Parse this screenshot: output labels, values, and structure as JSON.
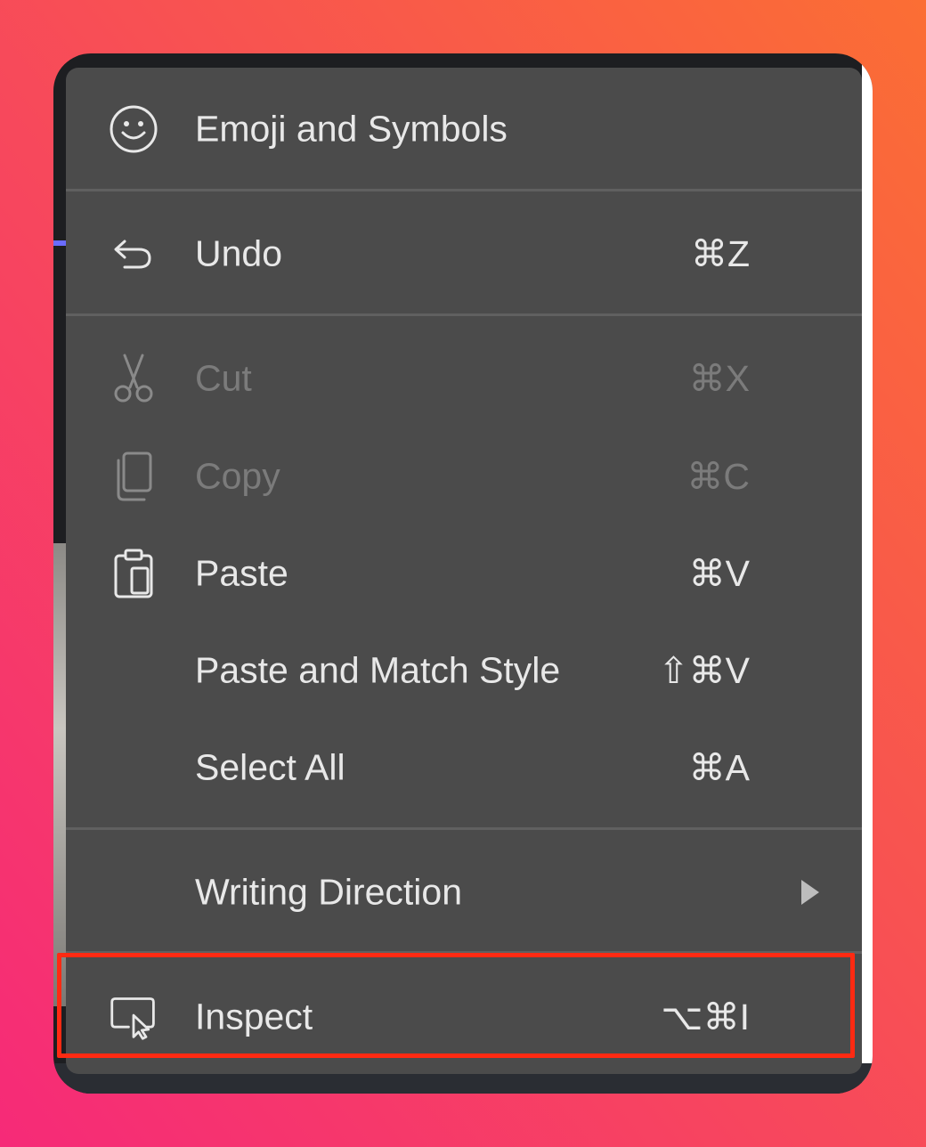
{
  "menu": {
    "items": [
      {
        "label": "Emoji and Symbols",
        "shortcut": "",
        "icon": "smiley-icon",
        "enabled": true
      },
      {
        "label": "Undo",
        "shortcut": "⌘Z",
        "icon": "undo-arrow-icon",
        "enabled": true
      },
      {
        "label": "Cut",
        "shortcut": "⌘X",
        "icon": "scissors-icon",
        "enabled": false
      },
      {
        "label": "Copy",
        "shortcut": "⌘C",
        "icon": "copy-documents-icon",
        "enabled": false
      },
      {
        "label": "Paste",
        "shortcut": "⌘V",
        "icon": "clipboard-icon",
        "enabled": true
      },
      {
        "label": "Paste and Match Style",
        "shortcut": "⇧⌘V",
        "icon": "",
        "enabled": true
      },
      {
        "label": "Select All",
        "shortcut": "⌘A",
        "icon": "",
        "enabled": true
      },
      {
        "label": "Writing Direction",
        "shortcut": "",
        "icon": "",
        "enabled": true,
        "submenu": true
      },
      {
        "label": "Inspect",
        "shortcut": "⌥⌘I",
        "icon": "inspect-pointer-icon",
        "enabled": true,
        "highlighted": true
      }
    ]
  },
  "colors": {
    "menu_background": "#4b4b4b",
    "text": "#e8e8e8",
    "text_disabled": "#7b7b7b",
    "highlight_border": "#ff2a12"
  }
}
